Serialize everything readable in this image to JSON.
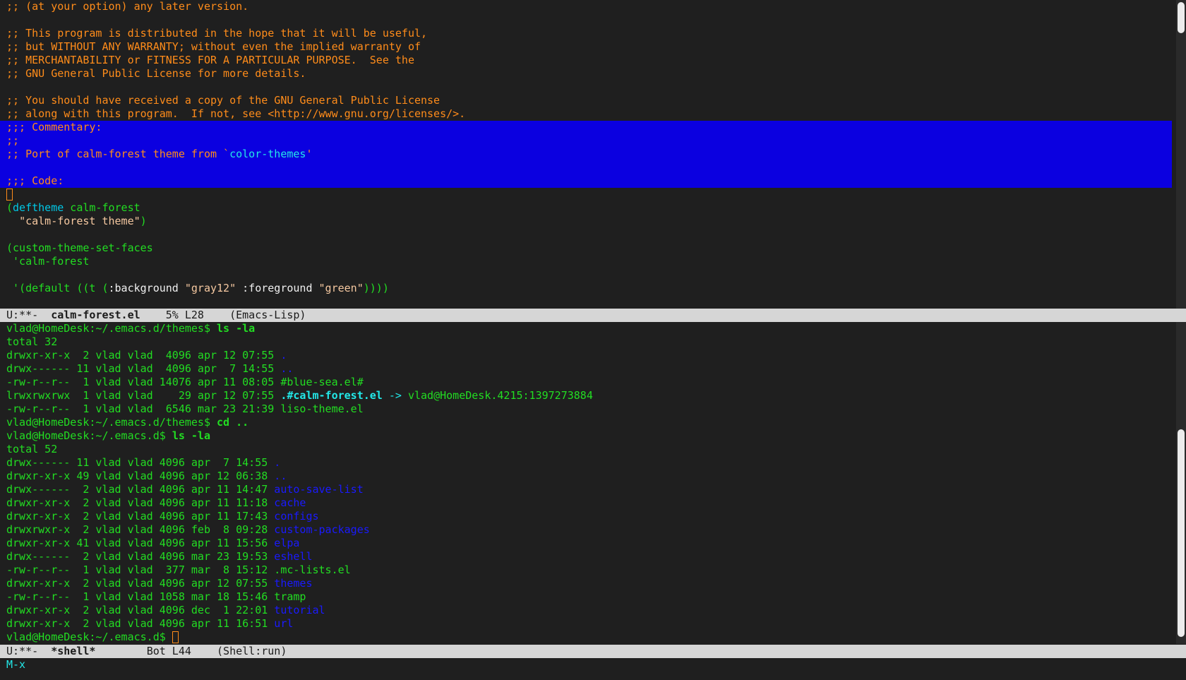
{
  "top_buffer": {
    "lines": [
      {
        "text": ";; (at your option) any later version.",
        "kind": "comment"
      },
      {
        "text": "",
        "kind": "comment"
      },
      {
        "text": ";; This program is distributed in the hope that it will be useful,",
        "kind": "comment"
      },
      {
        "text": ";; but WITHOUT ANY WARRANTY; without even the implied warranty of",
        "kind": "comment"
      },
      {
        "text": ";; MERCHANTABILITY or FITNESS FOR A PARTICULAR PURPOSE.  See the",
        "kind": "comment"
      },
      {
        "text": ";; GNU General Public License for more details.",
        "kind": "comment"
      },
      {
        "text": "",
        "kind": "comment"
      },
      {
        "text": ";; You should have received a copy of the GNU General Public License",
        "kind": "comment"
      },
      {
        "text": ";; along with this program.  If not, see <http://www.gnu.org/licenses/>.",
        "kind": "comment"
      }
    ],
    "region": {
      "line1": ";;; Commentary:",
      "line2": ";;",
      "line3_prefix": ";; Port of calm-forest theme from `",
      "line3_ref": "color-themes",
      "line3_suffix": "'",
      "line5": ";;; Code:"
    },
    "code": {
      "deftheme_open": "(",
      "deftheme_kw": "deftheme",
      "deftheme_name": " calm-forest",
      "deftheme_doc_indent": "  ",
      "deftheme_doc": "\"calm-forest theme\"",
      "deftheme_close": ")",
      "custom_line": "(custom-theme-set-faces",
      "custom_name": " 'calm-forest",
      "default_open": " '(default ((t (",
      "default_bg_key": ":background",
      "default_bg_val": "\"gray12\"",
      "default_fg_key": ":foreground",
      "default_fg_val": "\"green\"",
      "default_close": "))))"
    },
    "modeline": {
      "status": "U:**-",
      "buffer": "calm-forest.el",
      "position": "5% L28",
      "mode": "(Emacs-Lisp)"
    }
  },
  "shell_buffer": {
    "prompt1": "vlad@HomeDesk:~/.emacs.d/themes$",
    "cmd1": "ls -la",
    "total1": "total 32",
    "listing1": [
      {
        "meta": "drwxr-xr-x  2 vlad vlad  4096 apr 12 07:55 ",
        "name": ".",
        "color": "blue"
      },
      {
        "meta": "drwx------ 11 vlad vlad  4096 apr  7 14:55 ",
        "name": "..",
        "color": "blue"
      },
      {
        "meta": "-rw-r--r--  1 vlad vlad 14076 apr 11 08:05 ",
        "name": "#blue-sea.el#",
        "color": "green"
      },
      {
        "meta": "lrwxrwxrwx  1 vlad vlad    29 apr 12 07:55 ",
        "name": ".#calm-forest.el",
        "color": "cyanbold",
        "link": " -> ",
        "target": "vlad@HomeDesk.4215:1397273884"
      },
      {
        "meta": "-rw-r--r--  1 vlad vlad  6546 mar 23 21:39 ",
        "name": "liso-theme.el",
        "color": "green"
      }
    ],
    "prompt2": "vlad@HomeDesk:~/.emacs.d/themes$",
    "cmd2": "cd ..",
    "prompt3": "vlad@HomeDesk:~/.emacs.d$",
    "cmd3": "ls -la",
    "total2": "total 52",
    "listing2": [
      {
        "meta": "drwx------ 11 vlad vlad 4096 apr  7 14:55 ",
        "name": ".",
        "color": "blue"
      },
      {
        "meta": "drwxr-xr-x 49 vlad vlad 4096 apr 12 06:38 ",
        "name": "..",
        "color": "blue"
      },
      {
        "meta": "drwx------  2 vlad vlad 4096 apr 11 14:47 ",
        "name": "auto-save-list",
        "color": "blue"
      },
      {
        "meta": "drwxr-xr-x  2 vlad vlad 4096 apr 11 11:18 ",
        "name": "cache",
        "color": "blue"
      },
      {
        "meta": "drwxr-xr-x  2 vlad vlad 4096 apr 11 17:43 ",
        "name": "configs",
        "color": "blue"
      },
      {
        "meta": "drwxrwxr-x  2 vlad vlad 4096 feb  8 09:28 ",
        "name": "custom-packages",
        "color": "blue"
      },
      {
        "meta": "drwxr-xr-x 41 vlad vlad 4096 apr 11 15:56 ",
        "name": "elpa",
        "color": "blue"
      },
      {
        "meta": "drwx------  2 vlad vlad 4096 mar 23 19:53 ",
        "name": "eshell",
        "color": "blue"
      },
      {
        "meta": "-rw-r--r--  1 vlad vlad  377 mar  8 15:12 ",
        "name": ".mc-lists.el",
        "color": "green"
      },
      {
        "meta": "drwxr-xr-x  2 vlad vlad 4096 apr 12 07:55 ",
        "name": "themes",
        "color": "blue"
      },
      {
        "meta": "-rw-r--r--  1 vlad vlad 1058 mar 18 15:46 ",
        "name": "tramp",
        "color": "green"
      },
      {
        "meta": "drwxr-xr-x  2 vlad vlad 4096 dec  1 22:01 ",
        "name": "tutorial",
        "color": "blue"
      },
      {
        "meta": "drwxr-xr-x  2 vlad vlad 4096 apr 11 16:51 ",
        "name": "url",
        "color": "blue"
      }
    ],
    "prompt4": "vlad@HomeDesk:~/.emacs.d$",
    "modeline": {
      "status": "U:**-",
      "buffer": "*shell*",
      "position": "Bot L44",
      "mode": "(Shell:run)"
    }
  },
  "minibuffer": {
    "text": "M-x"
  }
}
